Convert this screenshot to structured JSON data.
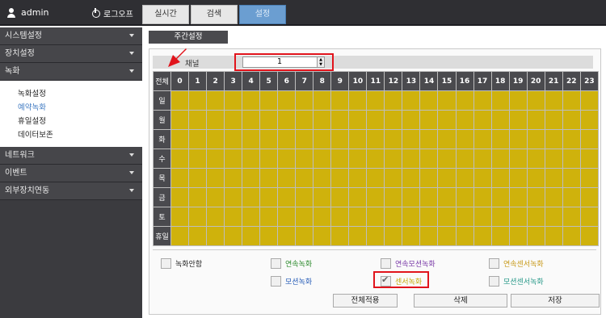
{
  "topbar": {
    "user": "admin",
    "logout": "로그오프",
    "tabs": [
      "실시간",
      "검색",
      "설정"
    ]
  },
  "sidebar": {
    "menus_top": [
      {
        "label": "시스템설정"
      },
      {
        "label": "장치설정"
      },
      {
        "label": "녹화"
      }
    ],
    "sub": [
      "녹화설정",
      "예약녹화",
      "휴일설정",
      "데이터보존"
    ],
    "menus_bottom": [
      {
        "label": "네트워크"
      },
      {
        "label": "이벤트"
      },
      {
        "label": "외부장치연동"
      }
    ]
  },
  "content": {
    "week_tab": "주간설정",
    "channel_label": "채널",
    "channel_value": "1",
    "grid_corner": "전체",
    "days": [
      "일",
      "월",
      "화",
      "수",
      "목",
      "금",
      "토",
      "휴일"
    ],
    "hours": [
      "0",
      "1",
      "2",
      "3",
      "4",
      "5",
      "6",
      "7",
      "8",
      "9",
      "10",
      "11",
      "12",
      "13",
      "14",
      "15",
      "16",
      "17",
      "18",
      "19",
      "20",
      "21",
      "22",
      "23"
    ]
  },
  "legend": [
    {
      "label": "녹화안함",
      "color": "#222222"
    },
    {
      "label": "연속녹화",
      "color": "#2e8b2e"
    },
    {
      "label": "연속모션녹화",
      "color": "#7a3aa8"
    },
    {
      "label": "연속센서녹화",
      "color": "#c89a1a"
    },
    {
      "label": "모션녹화",
      "color": "#2a5fb8"
    },
    {
      "label": "센서녹화",
      "color": "#c7a80a"
    },
    {
      "label": "모션센서녹화",
      "color": "#2a9a8a"
    }
  ],
  "buttons": {
    "apply_all": "전체적용",
    "delete": "삭제",
    "save": "저장"
  }
}
